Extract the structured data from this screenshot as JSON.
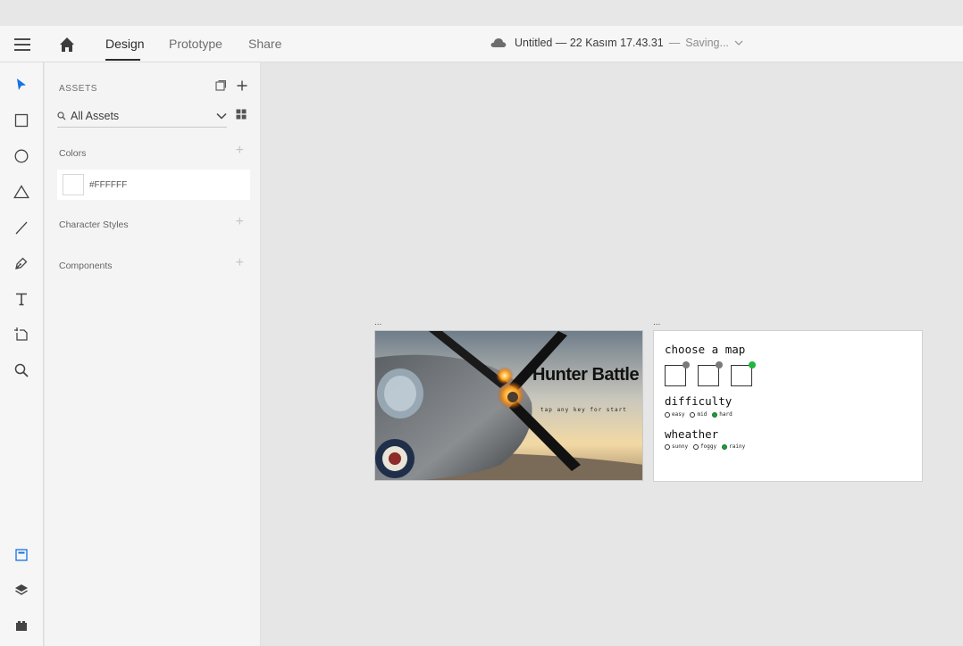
{
  "topbar": {
    "tabs": [
      {
        "label": "Design",
        "active": true
      },
      {
        "label": "Prototype",
        "active": false
      },
      {
        "label": "Share",
        "active": false
      }
    ],
    "document_title": "Untitled — 22 Kasım 17.43.31",
    "document_separator": "—",
    "document_status": "Saving..."
  },
  "toolbar": {
    "tools": [
      "select-icon",
      "rectangle-icon",
      "ellipse-icon",
      "triangle-icon",
      "line-icon",
      "pen-icon",
      "text-icon",
      "artboard-icon",
      "zoom-icon"
    ],
    "bottom": [
      "assets-icon",
      "layers-icon",
      "plugins-icon"
    ],
    "accent_color": "#1473e6"
  },
  "assets": {
    "title": "ASSETS",
    "filter_label": "All Assets",
    "sections": {
      "colors": "Colors",
      "character_styles": "Character Styles",
      "components": "Components"
    },
    "colors": [
      {
        "label": "#FFFFFF",
        "value": "#FFFFFF"
      }
    ]
  },
  "canvas": {
    "artboard1": {
      "label": "...",
      "title": "Hunter Battle",
      "subtitle": "tap any key for start"
    },
    "artboard2": {
      "label": "...",
      "choose_map": "choose a map",
      "maps_selected": [
        false,
        false,
        true
      ],
      "difficulty_title": "difficulty",
      "difficulty_options": [
        {
          "label": "easy",
          "selected": false
        },
        {
          "label": "mid",
          "selected": false
        },
        {
          "label": "hard",
          "selected": true
        }
      ],
      "weather_title": "wheather",
      "weather_options": [
        {
          "label": "sunny",
          "selected": false
        },
        {
          "label": "foggy",
          "selected": false
        },
        {
          "label": "rainy",
          "selected": true
        }
      ]
    }
  }
}
